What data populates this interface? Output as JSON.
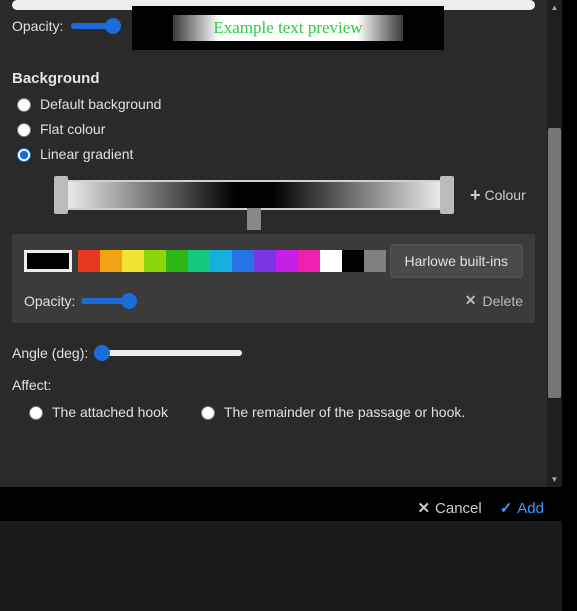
{
  "preview": {
    "text": "Example text preview"
  },
  "top_opacity": {
    "label": "Opacity:"
  },
  "background": {
    "heading": "Background",
    "options": {
      "default": "Default background",
      "flat": "Flat colour",
      "linear": "Linear gradient"
    },
    "add_colour_label": "Colour"
  },
  "stop": {
    "builtin_label": "Harlowe built-ins",
    "opacity_label": "Opacity:",
    "delete_label": "Delete",
    "palette": [
      "#e63a1f",
      "#f2a314",
      "#f0e431",
      "#8ad80c",
      "#2fb815",
      "#17c97f",
      "#17aee0",
      "#2573e6",
      "#7a36e6",
      "#c41fe6",
      "#ef1fb0",
      "#ffffff",
      "#000000",
      "#808080"
    ]
  },
  "angle": {
    "label": "Angle (deg):"
  },
  "affect": {
    "label": "Affect:",
    "hook": "The attached hook",
    "remainder": "The remainder of the passage or hook."
  },
  "footer": {
    "cancel": "Cancel",
    "add": "Add"
  }
}
